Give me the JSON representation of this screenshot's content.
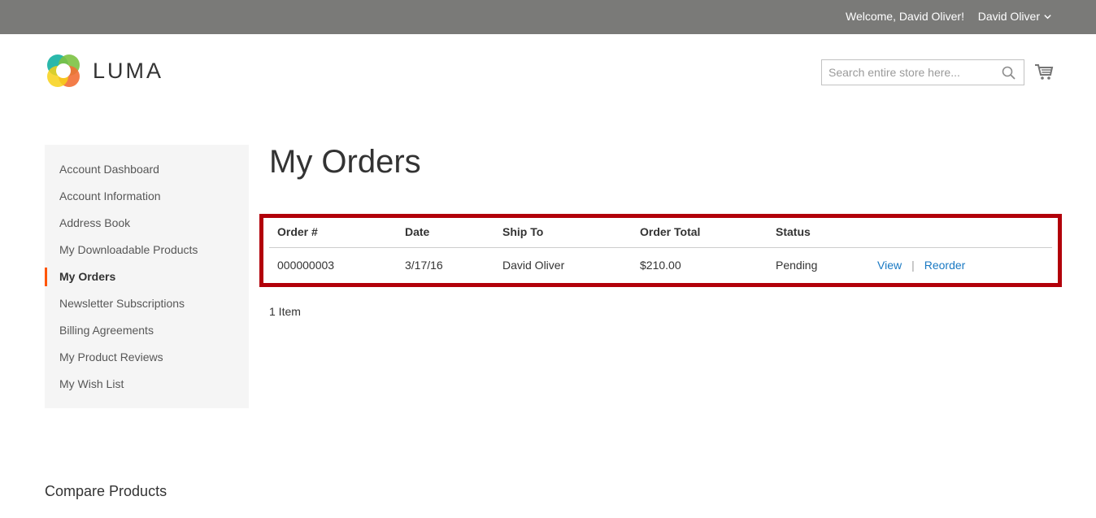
{
  "header": {
    "welcome": "Welcome, David Oliver!",
    "account_name": "David Oliver",
    "logo_text": "LUMA",
    "search_placeholder": "Search entire store here..."
  },
  "sidebar": {
    "items": [
      {
        "label": "Account Dashboard",
        "active": false
      },
      {
        "label": "Account Information",
        "active": false
      },
      {
        "label": "Address Book",
        "active": false
      },
      {
        "label": "My Downloadable Products",
        "active": false
      },
      {
        "label": "My Orders",
        "active": true
      },
      {
        "label": "Newsletter Subscriptions",
        "active": false
      },
      {
        "label": "Billing Agreements",
        "active": false
      },
      {
        "label": "My Product Reviews",
        "active": false
      },
      {
        "label": "My Wish List",
        "active": false
      }
    ]
  },
  "main": {
    "title": "My Orders",
    "table": {
      "columns": [
        "Order #",
        "Date",
        "Ship To",
        "Order Total",
        "Status"
      ],
      "rows": [
        {
          "order": "000000003",
          "date": "3/17/16",
          "ship_to": "David Oliver",
          "total": "$210.00",
          "status": "Pending",
          "view_label": "View",
          "separator": "|",
          "reorder_label": "Reorder"
        }
      ]
    },
    "item_count": "1 Item"
  },
  "footer": {
    "compare_title": "Compare Products"
  },
  "colors": {
    "topbar": "#7a7a78",
    "accent": "#ff5501",
    "link": "#1979c3",
    "highlight_border": "#b2000a"
  },
  "icons": [
    "chevron-down-icon",
    "search-icon",
    "cart-icon",
    "luma-logo-icon"
  ]
}
